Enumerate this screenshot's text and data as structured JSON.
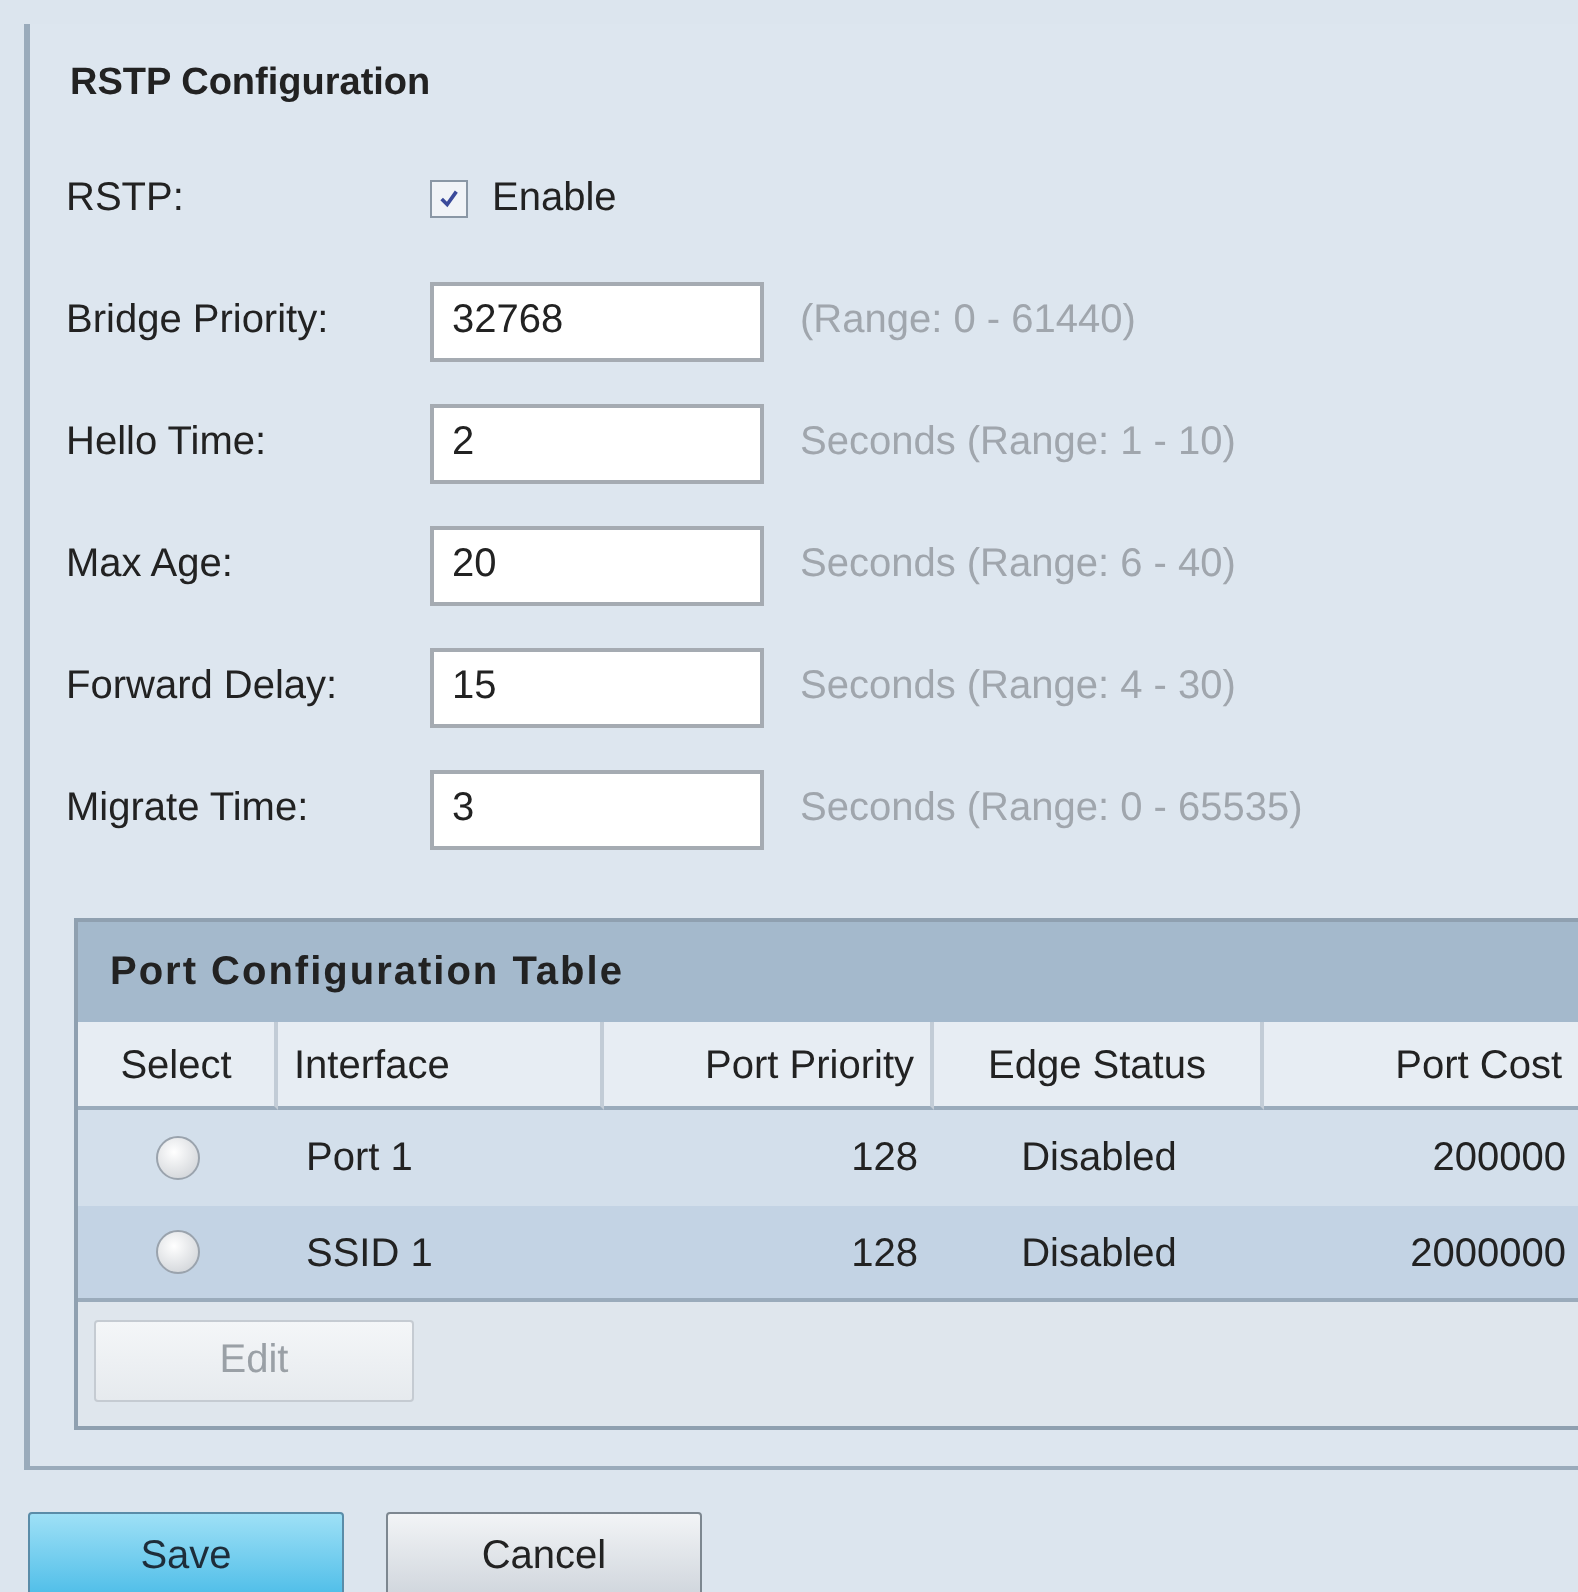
{
  "section": {
    "title": "RSTP Configuration"
  },
  "rstp": {
    "label": "RSTP:",
    "option": "Enable",
    "checked": true
  },
  "fields": [
    {
      "label": "Bridge Priority:",
      "value": "32768",
      "hint": "(Range: 0 - 61440)"
    },
    {
      "label": "Hello Time:",
      "value": "2",
      "hint": "Seconds (Range: 1 - 10)"
    },
    {
      "label": "Max Age:",
      "value": "20",
      "hint": "Seconds (Range: 6 - 40)"
    },
    {
      "label": "Forward Delay:",
      "value": "15",
      "hint": "Seconds (Range: 4 - 30)"
    },
    {
      "label": "Migrate Time:",
      "value": "3",
      "hint": "Seconds (Range: 0 - 65535)"
    }
  ],
  "table": {
    "title": "Port Configuration Table",
    "columns": [
      "Select",
      "Interface",
      "Port Priority",
      "Edge Status",
      "Port Cost"
    ],
    "rows": [
      {
        "selected": false,
        "interface": "Port 1",
        "port_priority": "128",
        "edge_status": "Disabled",
        "port_cost": "200000"
      },
      {
        "selected": false,
        "interface": "SSID 1",
        "port_priority": "128",
        "edge_status": "Disabled",
        "port_cost": "2000000"
      }
    ],
    "edit_button": {
      "label": "Edit",
      "disabled": true
    }
  },
  "buttons": [
    {
      "label": "Save",
      "kind": "primary"
    },
    {
      "label": "Cancel",
      "kind": "secondary"
    }
  ]
}
